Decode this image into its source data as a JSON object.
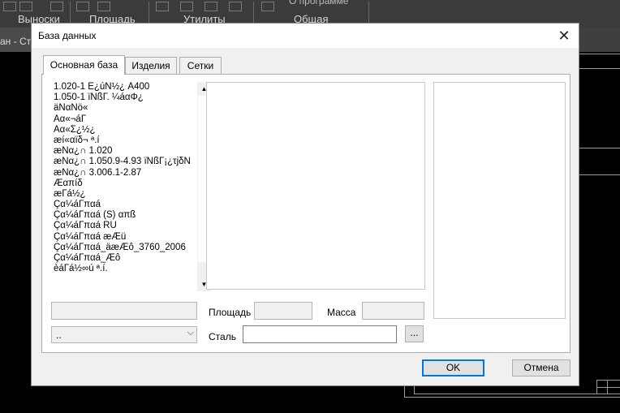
{
  "background": {
    "ribbon_labels": [
      "Выноски",
      "Площадь",
      "Утилиты",
      "Общая",
      "О программе"
    ],
    "title_fragment": "ан - Ста"
  },
  "dialog": {
    "title": "База данных",
    "close_glyph": "✕",
    "tabs": [
      {
        "label": "Основная база",
        "active": true
      },
      {
        "label": "Изделия",
        "active": false
      },
      {
        "label": "Сетки",
        "active": false
      }
    ],
    "db_list": [
      "1.020-1 É¿úÑ½¿ À400",
      "1.050-1 ïÑßГ. ¼áαΦ¿",
      "äÑαÑö«",
      "Аα«¬áГ",
      "Аα«Σ¿½¿",
      "æí«αïδ¬ ª.í",
      "æÑα¿∩ 1.020",
      "æÑα¿∩ 1.050.9-4.93 ïÑßГ¡¿τjδÑ",
      "æÑα¿∩ 3.006.1-2.87",
      "Æαπíδ",
      "æГá½¿",
      "Çα¼áГπαá",
      "Çα¼áГπαá (S) απß",
      "Çα¼áГπαá RU",
      "Çα¼áГπαá æÆü",
      "Çα¼áГπαá_äæÆô_3760_2006",
      "Çα¼áГπαá_Æô",
      "èáГá½∞ú ª.í."
    ],
    "list_scroll": {
      "up": "▲",
      "down": "▼"
    },
    "select_value": "..",
    "select_arrow": "⌵",
    "labels": {
      "area": "Площадь",
      "mass": "Масса",
      "steel": "Сталь"
    },
    "steel_value": "",
    "browse_label": "...",
    "buttons": {
      "ok": "OK",
      "cancel": "Отмена"
    }
  },
  "colors": {
    "focus_border": "#0078d7",
    "dialog_bg": "#f0f0f0",
    "app_bg": "#000000"
  }
}
